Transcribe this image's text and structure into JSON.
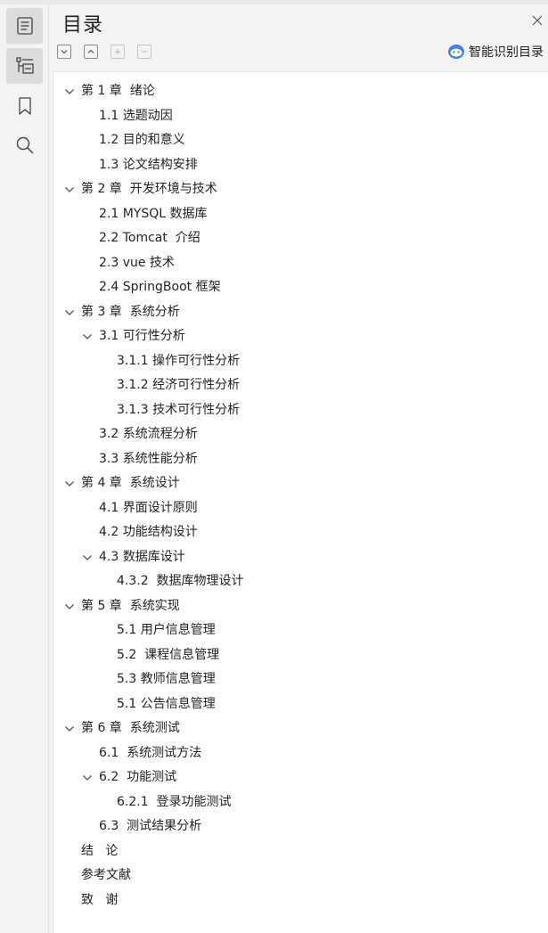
{
  "panel": {
    "title": "目录",
    "ai_label": "智能识别目录"
  },
  "sidebar": {
    "items": [
      {
        "name": "outline-icon"
      },
      {
        "name": "toc-icon"
      },
      {
        "name": "bookmark-icon"
      },
      {
        "name": "search-icon"
      }
    ]
  },
  "toc": [
    {
      "label": "第 1 章  绪论",
      "level": 0,
      "expanded": true
    },
    {
      "label": "1.1 选题动因",
      "level": 1
    },
    {
      "label": "1.2 目的和意义",
      "level": 1
    },
    {
      "label": "1.3 论文结构安排",
      "level": 1
    },
    {
      "label": "第 2 章  开发环境与技术",
      "level": 0,
      "expanded": true
    },
    {
      "label": "2.1 MYSQL 数据库",
      "level": 1
    },
    {
      "label": "2.2 Tomcat  介绍",
      "level": 1
    },
    {
      "label": "2.3 vue 技术",
      "level": 1
    },
    {
      "label": "2.4 SpringBoot 框架",
      "level": 1
    },
    {
      "label": "第 3 章  系统分析",
      "level": 0,
      "expanded": true
    },
    {
      "label": "3.1 可行性分析",
      "level": 1,
      "expanded": true
    },
    {
      "label": "3.1.1 操作可行性分析",
      "level": 2
    },
    {
      "label": "3.1.2 经济可行性分析",
      "level": 2
    },
    {
      "label": "3.1.3 技术可行性分析",
      "level": 2
    },
    {
      "label": "3.2 系统流程分析",
      "level": 1
    },
    {
      "label": "3.3 系统性能分析",
      "level": 1
    },
    {
      "label": "第 4 章  系统设计",
      "level": 0,
      "expanded": true
    },
    {
      "label": "4.1 界面设计原则",
      "level": 1
    },
    {
      "label": "4.2 功能结构设计",
      "level": 1
    },
    {
      "label": "4.3 数据库设计",
      "level": 1,
      "expanded": true
    },
    {
      "label": "4.3.2  数据库物理设计",
      "level": 2
    },
    {
      "label": "第 5 章  系统实现",
      "level": 0,
      "expanded": true
    },
    {
      "label": "5.1 用户信息管理",
      "level": 2
    },
    {
      "label": "5.2  课程信息管理",
      "level": 2
    },
    {
      "label": "5.3 教师信息管理",
      "level": 2
    },
    {
      "label": "5.1 公告信息管理",
      "level": 2
    },
    {
      "label": "第 6 章  系统测试",
      "level": 0,
      "expanded": true
    },
    {
      "label": "6.1  系统测试方法",
      "level": 1
    },
    {
      "label": "6.2  功能测试",
      "level": 1,
      "expanded": true
    },
    {
      "label": "6.2.1  登录功能测试",
      "level": 2
    },
    {
      "label": "6.3  测试结果分析",
      "level": 1
    },
    {
      "label": "结   论",
      "level": 0
    },
    {
      "label": "参考文献",
      "level": 0
    },
    {
      "label": "致   谢",
      "level": 0
    }
  ]
}
